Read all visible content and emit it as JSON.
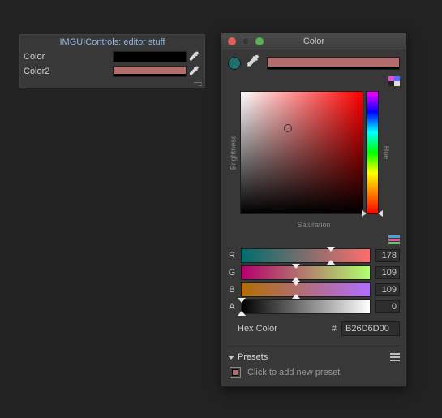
{
  "panel": {
    "title": "IMGUIControls: editor stuff",
    "rows": [
      {
        "label": "Color",
        "color": "#000000",
        "alpha": 0
      },
      {
        "label": "Color2",
        "color": "#b26d6d",
        "alpha": 0
      }
    ]
  },
  "picker": {
    "title": "Color",
    "traffic": {
      "close": "#e06058",
      "min": "#383838",
      "max": "#55b353"
    },
    "old_color": "#1f6f6f",
    "current_color": "#b26d6d",
    "axes": {
      "brightness": "Brightness",
      "hue": "Hue",
      "saturation": "Saturation"
    },
    "sv_marker": {
      "x_pct": 38.6,
      "y_pct": 30.2
    },
    "hue_marker_pct": 100,
    "channels": {
      "R": {
        "label": "R",
        "value": 178,
        "pct": 69.8
      },
      "G": {
        "label": "G",
        "value": 109,
        "pct": 42.7
      },
      "B": {
        "label": "B",
        "value": 109,
        "pct": 42.7
      },
      "A": {
        "label": "A",
        "value": 0,
        "pct": 0
      }
    },
    "hex": {
      "label": "Hex Color",
      "prefix": "#",
      "value": "B26D6D00"
    },
    "presets": {
      "header": "Presets",
      "hint": "Click to add new preset"
    }
  }
}
